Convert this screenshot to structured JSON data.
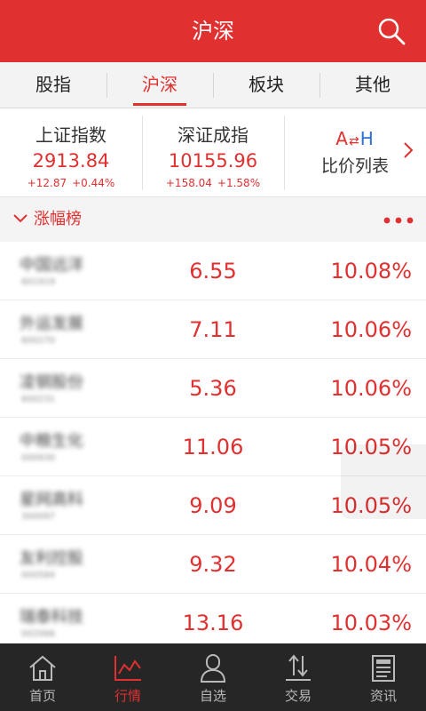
{
  "header": {
    "title": "沪深"
  },
  "tabs": [
    {
      "label": "股指"
    },
    {
      "label": "沪深"
    },
    {
      "label": "板块"
    },
    {
      "label": "其他"
    }
  ],
  "indices": [
    {
      "name": "上证指数",
      "value": "2913.84",
      "change": "+12.87",
      "pct": "+0.44%"
    },
    {
      "name": "深证成指",
      "value": "10155.96",
      "change": "+158.04",
      "pct": "+1.58%"
    }
  ],
  "ah": {
    "logo_a": "A",
    "logo_h": "H",
    "label": "比价列表"
  },
  "section": {
    "label": "涨幅榜"
  },
  "stocks": [
    {
      "name": "中国远洋",
      "code": "601919",
      "price": "6.55",
      "pct": "10.08%"
    },
    {
      "name": "外运发展",
      "code": "600270",
      "price": "7.11",
      "pct": "10.06%"
    },
    {
      "name": "凌钢股份",
      "code": "600231",
      "price": "5.36",
      "pct": "10.06%"
    },
    {
      "name": "中粮生化",
      "code": "000930",
      "price": "11.06",
      "pct": "10.05%"
    },
    {
      "name": "星网高科",
      "code": "300097",
      "price": "9.09",
      "pct": "10.05%"
    },
    {
      "name": "友利控股",
      "code": "000584",
      "price": "9.32",
      "pct": "10.04%"
    },
    {
      "name": "瑞泰科技",
      "code": "002066",
      "price": "13.16",
      "pct": "10.03%"
    }
  ],
  "nav": [
    {
      "label": "首页",
      "icon": "home-icon"
    },
    {
      "label": "行情",
      "icon": "chart-icon"
    },
    {
      "label": "自选",
      "icon": "user-icon"
    },
    {
      "label": "交易",
      "icon": "trade-icon"
    },
    {
      "label": "资讯",
      "icon": "news-icon"
    }
  ],
  "colors": {
    "accent": "#e03030",
    "nav_bg": "#262626"
  }
}
